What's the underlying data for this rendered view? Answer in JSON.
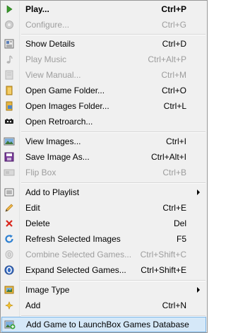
{
  "menu": {
    "items": [
      {
        "label": "Play...",
        "shortcut": "Ctrl+P",
        "icon": "play-icon",
        "bold": true,
        "disabled": false
      },
      {
        "label": "Configure...",
        "shortcut": "Ctrl+G",
        "icon": "configure-icon",
        "bold": false,
        "disabled": true
      },
      {
        "label": "Show Details",
        "shortcut": "Ctrl+D",
        "icon": "details-icon",
        "bold": false,
        "disabled": false
      },
      {
        "label": "Play Music",
        "shortcut": "Ctrl+Alt+P",
        "icon": "music-icon",
        "bold": false,
        "disabled": true
      },
      {
        "label": "View Manual...",
        "shortcut": "Ctrl+M",
        "icon": "manual-icon",
        "bold": false,
        "disabled": true
      },
      {
        "label": "Open Game Folder...",
        "shortcut": "Ctrl+O",
        "icon": "folder-icon",
        "bold": false,
        "disabled": false
      },
      {
        "label": "Open Images Folder...",
        "shortcut": "Ctrl+L",
        "icon": "images-folder-icon",
        "bold": false,
        "disabled": false
      },
      {
        "label": "Open Retroarch...",
        "shortcut": "",
        "icon": "retroarch-icon",
        "bold": false,
        "disabled": false
      },
      {
        "label": "View Images...",
        "shortcut": "Ctrl+I",
        "icon": "view-images-icon",
        "bold": false,
        "disabled": false
      },
      {
        "label": "Save Image As...",
        "shortcut": "Ctrl+Alt+I",
        "icon": "save-icon",
        "bold": false,
        "disabled": false
      },
      {
        "label": "Flip Box",
        "shortcut": "Ctrl+B",
        "icon": "flip-box-icon",
        "bold": false,
        "disabled": true
      },
      {
        "label": "Add to Playlist",
        "shortcut": "",
        "icon": "playlist-icon",
        "bold": false,
        "disabled": false,
        "submenu": true
      },
      {
        "label": "Edit",
        "shortcut": "Ctrl+E",
        "icon": "pencil-icon",
        "bold": false,
        "disabled": false
      },
      {
        "label": "Delete",
        "shortcut": "Del",
        "icon": "delete-icon",
        "bold": false,
        "disabled": false
      },
      {
        "label": "Refresh Selected Images",
        "shortcut": "F5",
        "icon": "refresh-icon",
        "bold": false,
        "disabled": false
      },
      {
        "label": "Combine Selected Games...",
        "shortcut": "Ctrl+Shift+C",
        "icon": "combine-icon",
        "bold": false,
        "disabled": true
      },
      {
        "label": "Expand Selected Games...",
        "shortcut": "Ctrl+Shift+E",
        "icon": "expand-icon",
        "bold": false,
        "disabled": false
      },
      {
        "label": "Image Type",
        "shortcut": "",
        "icon": "image-type-icon",
        "bold": false,
        "disabled": false,
        "submenu": true
      },
      {
        "label": "Add",
        "shortcut": "Ctrl+N",
        "icon": "add-icon",
        "bold": false,
        "disabled": false
      },
      {
        "label": "Add Game to LaunchBox Games Database",
        "shortcut": "",
        "icon": "add-database-icon",
        "bold": false,
        "disabled": false,
        "highlighted": true
      }
    ]
  },
  "colors": {
    "menu_background": "#f0f0f0",
    "highlight_background": "#d5e8f8",
    "highlight_border": "#7ab5e8",
    "disabled_text": "#9d9d9d"
  }
}
